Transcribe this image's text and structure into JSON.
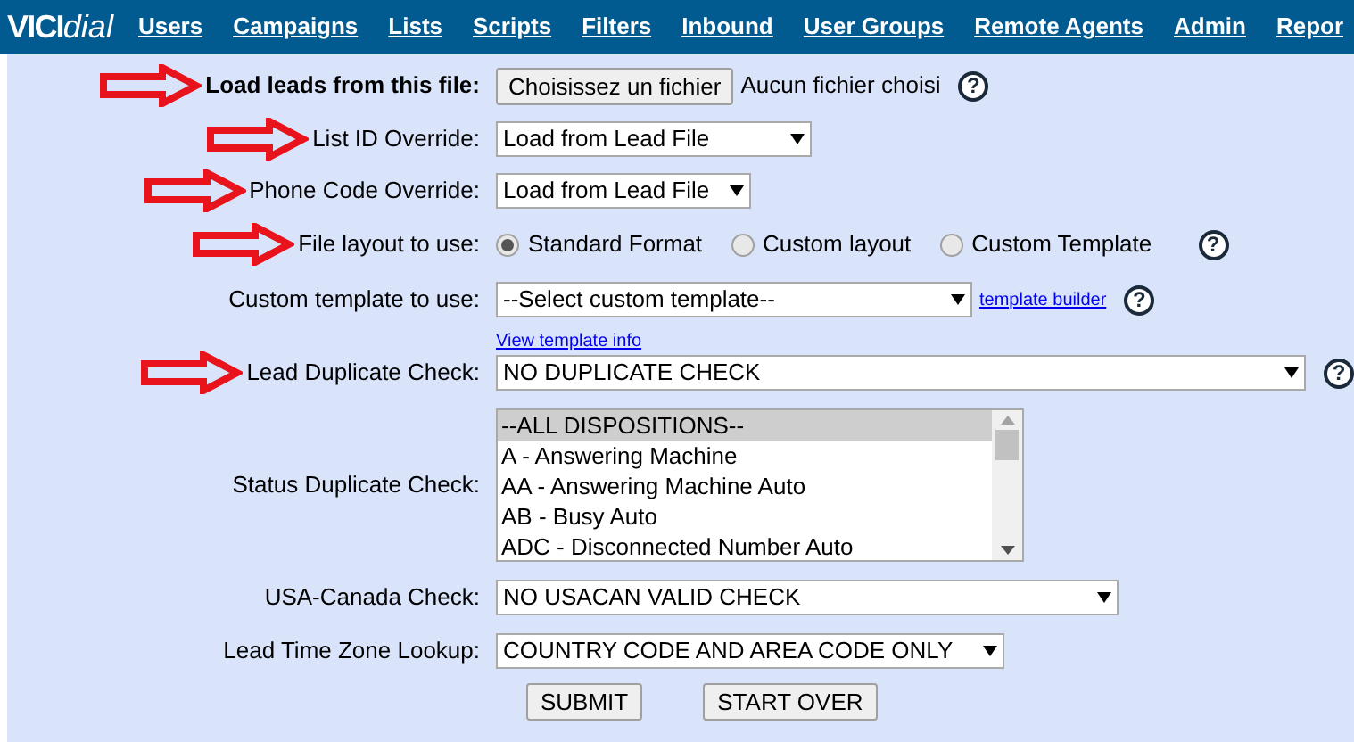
{
  "nav": {
    "logo_bold": "VICI",
    "logo_light": "dial",
    "items": [
      "Users",
      "Campaigns",
      "Lists",
      "Scripts",
      "Filters",
      "Inbound",
      "User Groups",
      "Remote Agents",
      "Admin",
      "Repor"
    ]
  },
  "form": {
    "rows": [
      {
        "kind": "file",
        "label": "Load leads from this file:",
        "bold": true,
        "arrow": true,
        "button": "Choisissez un fichier",
        "value": "Aucun fichier choisi",
        "help": "?"
      },
      {
        "kind": "select",
        "label": "List ID Override:",
        "bold": false,
        "arrow": true,
        "value": "Load from Lead File"
      },
      {
        "kind": "select",
        "label": "Phone Code Override:",
        "bold": false,
        "arrow": true,
        "value": "Load from Lead File"
      },
      {
        "kind": "radio",
        "label": "File layout to use:",
        "bold": false,
        "arrow": true,
        "options": [
          {
            "label": "Standard Format",
            "selected": true
          },
          {
            "label": "Custom layout",
            "selected": false
          },
          {
            "label": "Custom Template",
            "selected": false
          }
        ],
        "help": "?"
      },
      {
        "kind": "template",
        "label": "Custom template to use:",
        "bold": false,
        "arrow": false,
        "value": "--Select custom template--",
        "link": "template builder",
        "info": "View template info",
        "help": "?"
      },
      {
        "kind": "select",
        "label": "Lead Duplicate Check:",
        "bold": false,
        "arrow": true,
        "value": "NO DUPLICATE CHECK",
        "help": "?"
      },
      {
        "kind": "list",
        "label": "Status Duplicate Check:",
        "bold": false,
        "arrow": false,
        "options": [
          {
            "label": "--ALL DISPOSITIONS--",
            "selected": true
          },
          {
            "label": "A - Answering Machine",
            "selected": false
          },
          {
            "label": "AA - Answering Machine Auto",
            "selected": false
          },
          {
            "label": "AB - Busy Auto",
            "selected": false
          },
          {
            "label": "ADC - Disconnected Number Auto",
            "selected": false
          }
        ]
      },
      {
        "kind": "select",
        "label": "USA-Canada Check:",
        "bold": false,
        "arrow": false,
        "value": "NO USACAN VALID CHECK"
      },
      {
        "kind": "select",
        "label": "Lead Time Zone Lookup:",
        "bold": false,
        "arrow": false,
        "value": "COUNTRY CODE AND AREA CODE ONLY"
      }
    ],
    "buttons": [
      "SUBMIT",
      "START OVER"
    ]
  }
}
